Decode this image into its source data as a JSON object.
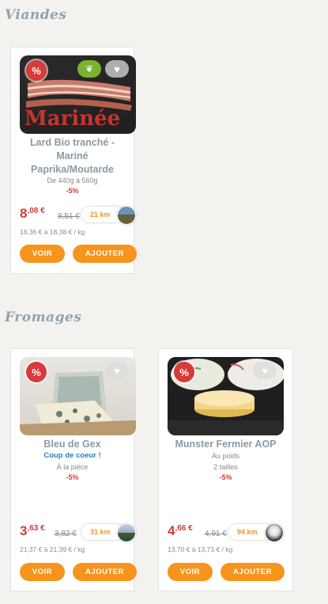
{
  "sections": [
    {
      "title": "Viandes",
      "products": [
        {
          "name_lines": [
            "Lard Bio tranché -",
            "Mariné",
            "Paprika/Moutarde"
          ],
          "photo_text": "Marinée",
          "weight": "De 440g à 560g",
          "discount": "-5%",
          "price_int": "8",
          "price_dec": ",08 €",
          "old_price": "8,51 €",
          "distance": "21 km",
          "unit_price": "18,36 € à 18,38 € / kg",
          "promo_icon": "percent-icon",
          "bio_icon": "leaf-icon",
          "heart_icon": "heart-icon"
        }
      ]
    },
    {
      "title": "Fromages",
      "products": [
        {
          "name_lines": [
            "Bleu de Gex"
          ],
          "tag": "Coup de coeur !",
          "weight": "À la pièce",
          "discount": "-5%",
          "price_int": "3",
          "price_dec": ",63 €",
          "old_price": "3,82 €",
          "distance": "31 km",
          "unit_price": "21,37 € à 21,39 € / kg"
        },
        {
          "name_lines": [
            "Munster Fermier AOP"
          ],
          "weight": "Au poids",
          "sizes": "2 tailles",
          "discount": "-5%",
          "price_int": "4",
          "price_dec": ",66 €",
          "old_price": "4,91 €",
          "distance": "94 km",
          "unit_price": "13,70 € à 13,73 € / kg"
        }
      ]
    }
  ],
  "buttons": {
    "view": "VOIR",
    "add": "AJOUTER"
  },
  "icons": {
    "promo": "%",
    "heart": "♥",
    "bio": "❦"
  },
  "colors": {
    "accent": "#f7941d",
    "price": "#d23b3b",
    "title": "#8a9aa3",
    "tag": "#2c7cc2"
  }
}
